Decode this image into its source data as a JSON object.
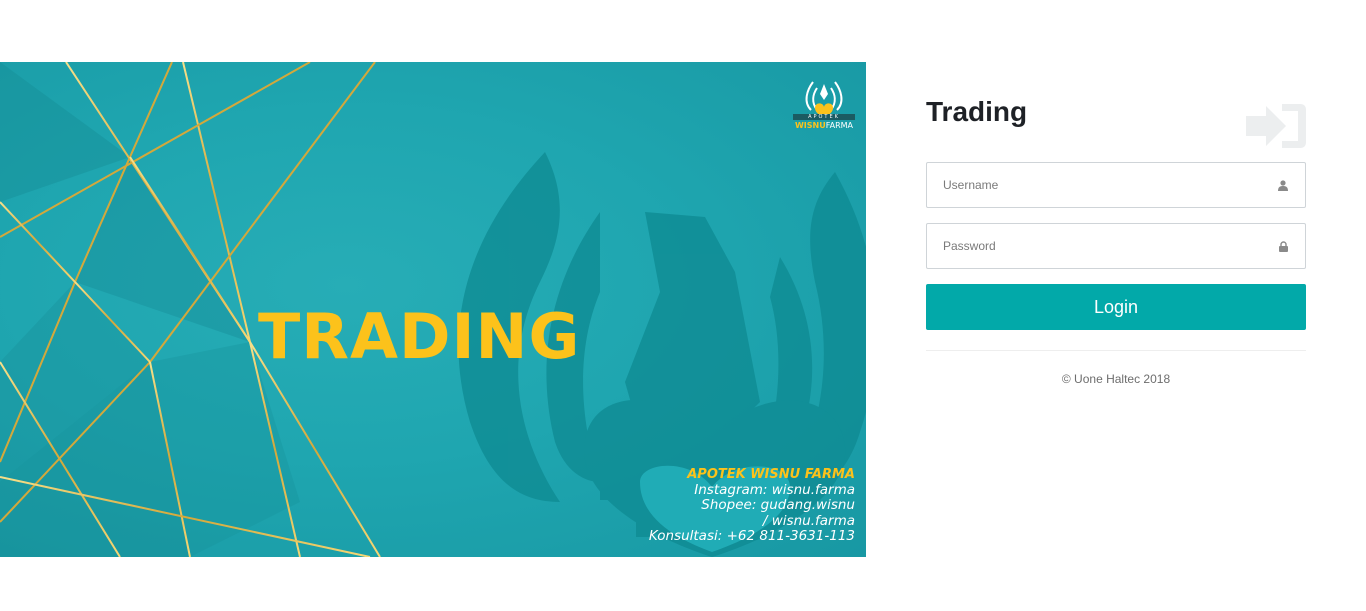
{
  "banner": {
    "title": "TRADING",
    "logo": {
      "top_text": "APOTEK",
      "name_part1": "WISNU",
      "name_part2": "FARMA"
    },
    "info": {
      "brand": "APOTEK WISNU FARMA",
      "instagram": "Instagram: wisnu.farma",
      "shopee_1": "Shopee: gudang.wisnu",
      "shopee_2": "/ wisnu.farma",
      "konsultasi": "Konsultasi: +62 811-3631-113"
    },
    "colors": {
      "background": "#1fa6b0",
      "accent": "#fcc21b",
      "gold_line": "#d9b24a"
    }
  },
  "login": {
    "title": "Trading",
    "header_icon": "sign-in-icon",
    "username": {
      "placeholder": "Username",
      "value": "",
      "icon": "user-icon"
    },
    "password": {
      "placeholder": "Password",
      "value": "",
      "icon": "lock-icon"
    },
    "submit_label": "Login",
    "footer": "© Uone Haltec 2018",
    "colors": {
      "button": "#02a9a9",
      "title": "#1e2126"
    }
  }
}
